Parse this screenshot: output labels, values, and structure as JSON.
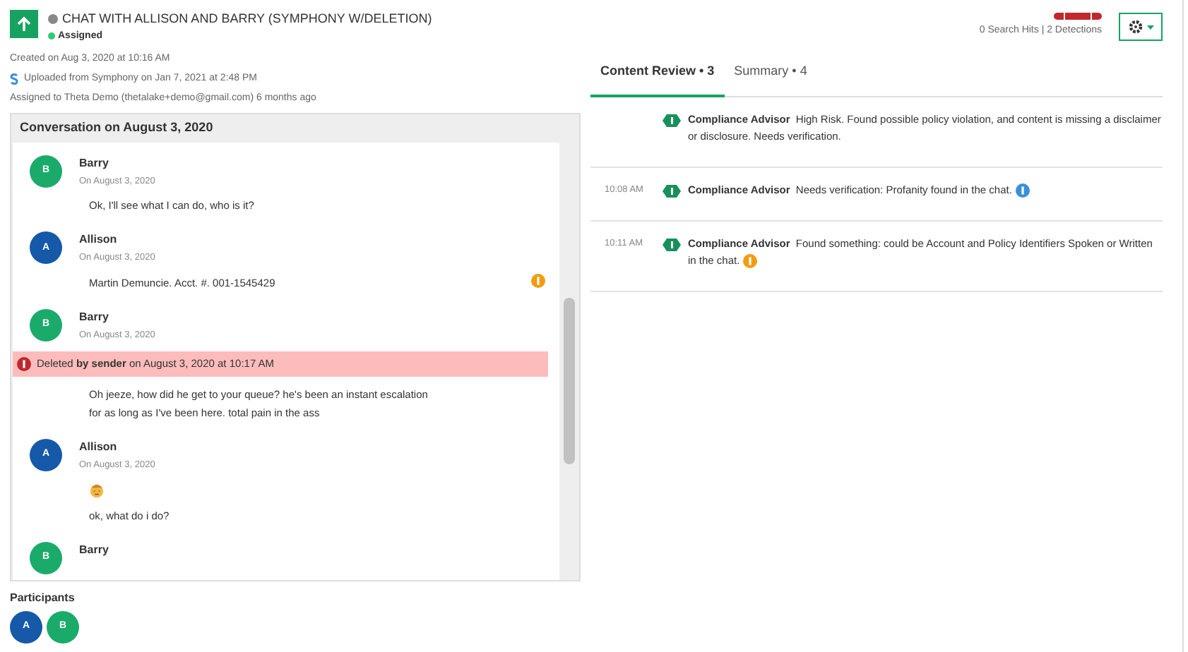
{
  "header": {
    "title": "CHAT WITH ALLISON AND BARRY (SYMPHONY W/DELETION)",
    "status": "Assigned",
    "created": "Created on Aug 3, 2020 at 10:16 AM",
    "uploaded": "Uploaded from Symphony on Jan 7, 2021 at 2:48 PM",
    "assigned": "Assigned to Theta Demo (thetalake+demo@gmail.com) 6 months ago",
    "hits": "0 Search Hits | 2 Detections"
  },
  "conversation": {
    "title": "Conversation on August 3, 2020",
    "messages": [
      {
        "initial": "B",
        "name": "Barry",
        "color": "#1aab6b",
        "date": "On August 3, 2020",
        "lines": [
          {
            "kind": "text",
            "text": "Ok, I'll see what I can do, who is it?"
          }
        ]
      },
      {
        "initial": "A",
        "name": "Allison",
        "color": "#1559a8",
        "date": "On August 3, 2020",
        "flag": {
          "color": "#f39c12"
        },
        "lines": [
          {
            "kind": "text",
            "text": "Martin Demuncie. Acct. #. 001-1545429"
          }
        ]
      },
      {
        "initial": "B",
        "name": "Barry",
        "color": "#1aab6b",
        "date": "On August 3, 2020",
        "lines": [
          {
            "kind": "deleted",
            "text": "Deleted **by sender** on August 3, 2020 at 10:17 AM"
          },
          {
            "kind": "text",
            "text": "Oh jeeze, how did he get to your queue? he's been an instant escalation\nfor as long as I've been here. total pain in the ass"
          }
        ]
      },
      {
        "initial": "A",
        "name": "Allison",
        "color": "#1559a8",
        "date": "On August 3, 2020",
        "lines": [
          {
            "kind": "emoji"
          },
          {
            "kind": "text",
            "text": "ok, what do i do?"
          }
        ]
      },
      {
        "initial": "B",
        "name": "Barry",
        "color": "#1aab6b"
      }
    ]
  },
  "participants": {
    "title": "Participants",
    "items": [
      {
        "initial": "A",
        "color": "#1559a8"
      },
      {
        "initial": "B",
        "color": "#1aab6b"
      }
    ]
  },
  "tabs": [
    {
      "label": "Content Review • 3",
      "selected": true
    },
    {
      "label": "Summary • 4",
      "selected": false
    }
  ],
  "findings": [
    {
      "source": "Compliance Advisor",
      "text": "High Risk. Found possible policy violation, and content is missing a disclaimer or disclosure. Needs verification."
    },
    {
      "time": "10:08 AM",
      "source": "Compliance Advisor",
      "text": "Needs verification: Profanity found in the chat.",
      "color": "#3a8fd9"
    },
    {
      "time": "10:11 AM",
      "source": "Compliance Advisor",
      "text": "Found something: could be Account and Policy Identifiers Spoken or Written in the chat.",
      "color": "#f39c12"
    }
  ]
}
